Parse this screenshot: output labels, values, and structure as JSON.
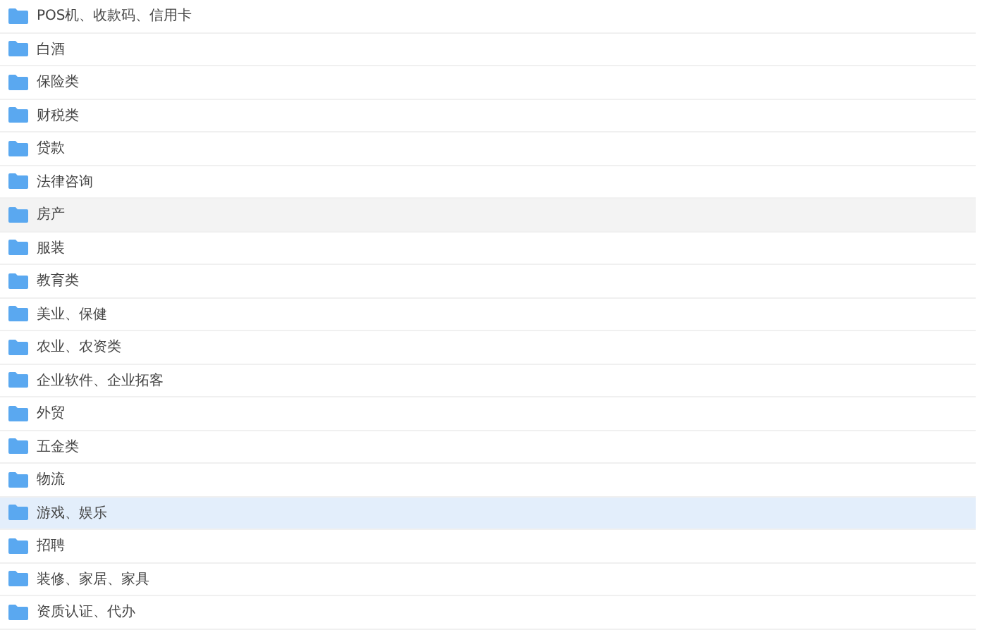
{
  "folders": [
    {
      "name": "POS机、收款码、信用卡",
      "selected": false,
      "hovered": false
    },
    {
      "name": "白酒",
      "selected": false,
      "hovered": false
    },
    {
      "name": "保险类",
      "selected": false,
      "hovered": false
    },
    {
      "name": "财税类",
      "selected": false,
      "hovered": false
    },
    {
      "name": "贷款",
      "selected": false,
      "hovered": false
    },
    {
      "name": "法律咨询",
      "selected": false,
      "hovered": false
    },
    {
      "name": "房产",
      "selected": false,
      "hovered": true
    },
    {
      "name": "服装",
      "selected": false,
      "hovered": false
    },
    {
      "name": "教育类",
      "selected": false,
      "hovered": false
    },
    {
      "name": "美业、保健",
      "selected": false,
      "hovered": false
    },
    {
      "name": "农业、农资类",
      "selected": false,
      "hovered": false
    },
    {
      "name": "企业软件、企业拓客",
      "selected": false,
      "hovered": false
    },
    {
      "name": "外贸",
      "selected": false,
      "hovered": false
    },
    {
      "name": "五金类",
      "selected": false,
      "hovered": false
    },
    {
      "name": "物流",
      "selected": false,
      "hovered": false
    },
    {
      "name": "游戏、娱乐",
      "selected": true,
      "hovered": false
    },
    {
      "name": "招聘",
      "selected": false,
      "hovered": false
    },
    {
      "name": "装修、家居、家具",
      "selected": false,
      "hovered": false
    },
    {
      "name": "资质认证、代办",
      "selected": false,
      "hovered": false
    }
  ]
}
